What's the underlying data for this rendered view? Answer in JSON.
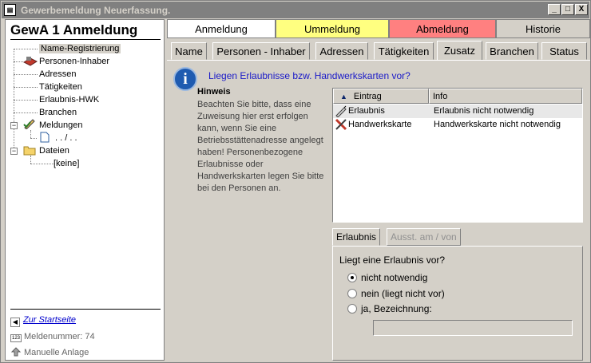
{
  "window": {
    "title": "Gewerbemeldung Neuerfassung.",
    "controls": [
      "_",
      "□",
      "X"
    ]
  },
  "left": {
    "app_title": "GewA 1 Anmeldung",
    "tree": [
      {
        "label": "Name-Registrierung"
      },
      {
        "label": "Personen-Inhaber"
      },
      {
        "label": "Adressen"
      },
      {
        "label": "Tätigkeiten"
      },
      {
        "label": "Erlaubnis-HWK"
      },
      {
        "label": "Branchen"
      },
      {
        "label": "Meldungen"
      },
      {
        "label": ". . / . ."
      },
      {
        "label": "Dateien"
      },
      {
        "label": "[keine]"
      }
    ],
    "start_link": "Zur Startseite",
    "meldenummer_label": "Meldenummer:",
    "meldenummer_value": "74",
    "manual_label": "Manuelle Anlage"
  },
  "top_tabs": [
    {
      "label": "Anmeldung",
      "color": "#ffffff"
    },
    {
      "label": "Ummeldung",
      "color": "#ffff80"
    },
    {
      "label": "Abmeldung",
      "color": "#ff8080"
    },
    {
      "label": "Historie",
      "color": "#d4d0c8"
    }
  ],
  "sub_tabs": [
    "Name",
    "Personen - Inhaber",
    "Adressen",
    "Tätigkeiten",
    "Zusatz",
    "Branchen",
    "Status"
  ],
  "content": {
    "question": "Liegen Erlaubnisse bzw. Handwerkskarten vor?",
    "hint_title": "Hinweis",
    "hint_text": "Beachten Sie bitte, dass eine Zuweisung hier erst erfolgen kann, wenn Sie eine Betriebsstättenadresse angelegt haben! Personenbezogene Erlaubnisse oder Handwerkskarten legen Sie bitte bei den Personen an.",
    "list_headers": [
      "Eintrag",
      "Info"
    ],
    "list_rows": [
      {
        "entry": "Erlaubnis",
        "info": "Erlaubnis nicht notwendig"
      },
      {
        "entry": "Handwerkskarte",
        "info": "Handwerkskarte nicht notwendig"
      }
    ],
    "group_tabs": [
      "Erlaubnis",
      "Ausst. am / von"
    ],
    "group_question": "Liegt eine Erlaubnis vor?",
    "radios": [
      {
        "label": "nicht notwendig",
        "checked": true
      },
      {
        "label": "nein (liegt nicht vor)",
        "checked": false
      },
      {
        "label": "ja, Bezeichnung:",
        "checked": false
      }
    ],
    "bezeichnung_value": ""
  }
}
